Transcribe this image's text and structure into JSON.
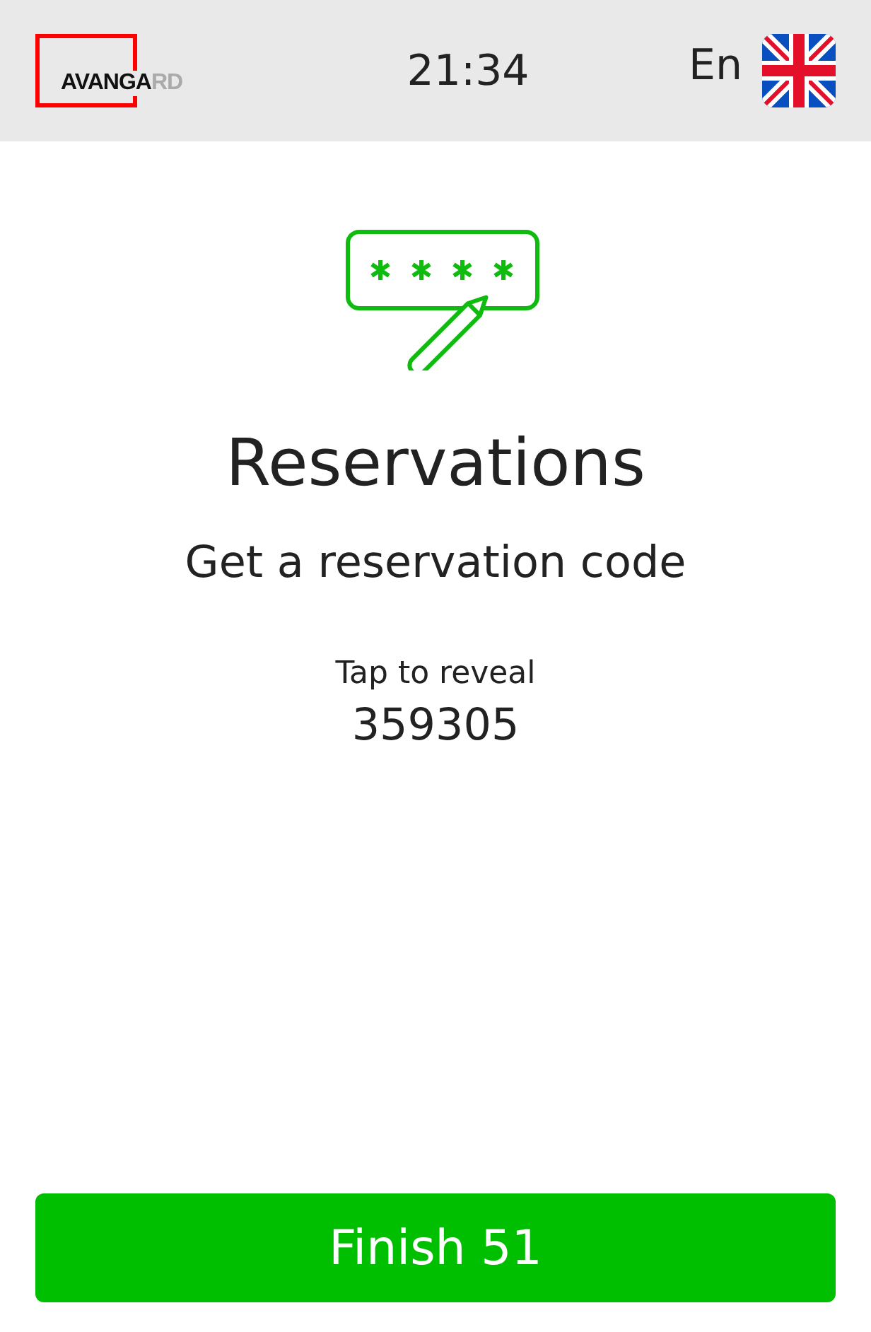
{
  "header": {
    "logo": {
      "dark": "AVANGA",
      "light": "RD"
    },
    "time": "21:34",
    "language": "En"
  },
  "title": "Reservations",
  "subtitle": "Get a reservation code",
  "hint": "Tap to reveal",
  "code": "359305",
  "button": {
    "label": "Finish 51"
  }
}
